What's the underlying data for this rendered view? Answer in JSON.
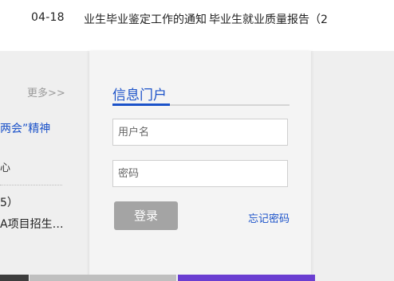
{
  "top": {
    "date": "04-18",
    "news_1": "业生毕业鉴定工作的通知",
    "news_2": "毕业生就业质量报告（2"
  },
  "left_news": {
    "more": "更多>>",
    "line1": "两会”精神",
    "line2": "心",
    "line3": "5）",
    "line4": "A项目招生…"
  },
  "login": {
    "title": "信息门户",
    "username_placeholder": "用户名",
    "password_placeholder": "密码",
    "login_button": "登录",
    "forgot_password": "忘记密码"
  },
  "colors": {
    "accent": "#1b52c9",
    "button": "#a4a4a4",
    "band": "#efefef"
  }
}
